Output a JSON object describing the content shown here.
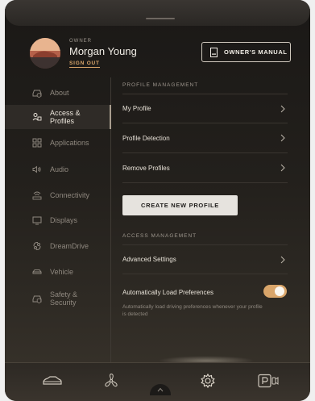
{
  "header": {
    "owner_label": "OWNER",
    "user_name": "Morgan Young",
    "sign_out": "SIGN OUT",
    "manual_button": "OWNER'S MANUAL"
  },
  "sidebar": {
    "items": [
      {
        "label": "About",
        "icon": "info-car-icon",
        "active": false
      },
      {
        "label": "Access & Profiles",
        "icon": "profiles-icon",
        "active": true
      },
      {
        "label": "Applications",
        "icon": "grid-icon",
        "active": false
      },
      {
        "label": "Audio",
        "icon": "speaker-icon",
        "active": false
      },
      {
        "label": "Connectivity",
        "icon": "signal-icon",
        "active": false
      },
      {
        "label": "Displays",
        "icon": "display-icon",
        "active": false
      },
      {
        "label": "DreamDrive",
        "icon": "dreamdrive-icon",
        "active": false
      },
      {
        "label": "Vehicle",
        "icon": "car-icon",
        "active": false
      },
      {
        "label": "Safety & Security",
        "icon": "safety-car-icon",
        "active": false
      }
    ]
  },
  "main": {
    "profile_header": "PROFILE MANAGEMENT",
    "profile_rows": [
      "My Profile",
      "Profile Detection",
      "Remove Profiles"
    ],
    "create_button": "CREATE NEW PROFILE",
    "access_header": "ACCESS MANAGEMENT",
    "advanced_settings": "Advanced Settings",
    "auto_load_label": "Automatically Load Preferences",
    "auto_load_desc": "Automatically load driving preferences whenever your profile is detected",
    "auto_load_on": true
  },
  "dock": {
    "icons": [
      "car-icon",
      "fan-icon",
      "settings-gear-icon",
      "parking-camera-icon"
    ]
  },
  "colors": {
    "accent": "#d9a56a",
    "background": "#1f1c19",
    "text": "#e8e2d8"
  }
}
